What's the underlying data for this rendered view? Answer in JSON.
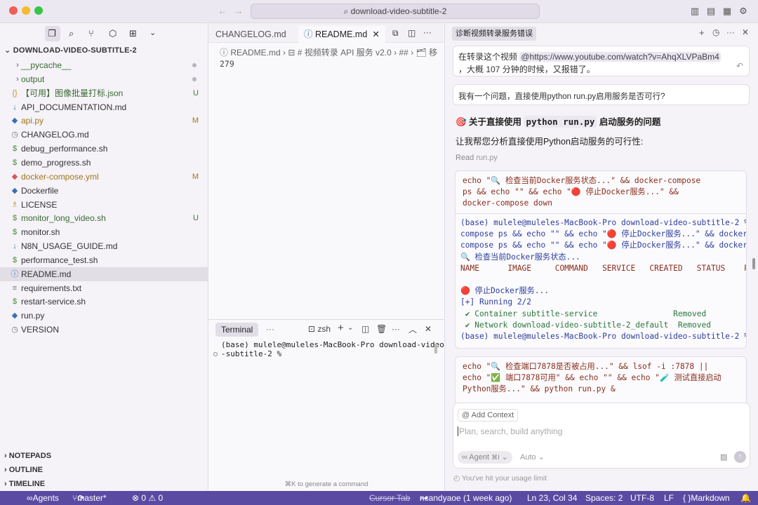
{
  "window": {
    "search": "download-video-subtitle-2"
  },
  "sidebar": {
    "root": "DOWNLOAD-VIDEO-SUBTITLE-2",
    "items": [
      {
        "name": "__pycache__",
        "icon": "›",
        "badge": "",
        "dot": true,
        "color": "#3a6b32"
      },
      {
        "name": "output",
        "icon": "›",
        "badge": "",
        "dot": true,
        "color": "#3a6b32"
      },
      {
        "name": "【可用】图像批量打标.json",
        "icon": "{}",
        "badge": "U",
        "dot": false,
        "color": "#3a6b32"
      },
      {
        "name": "API_DOCUMENTATION.md",
        "icon": "↓",
        "badge": "",
        "dot": false,
        "color": "#333"
      },
      {
        "name": "api.py",
        "icon": "◆",
        "badge": "M",
        "dot": false,
        "color": "#a0781a"
      },
      {
        "name": "CHANGELOG.md",
        "icon": "◷",
        "badge": "",
        "dot": false,
        "color": "#333"
      },
      {
        "name": "debug_performance.sh",
        "icon": "$",
        "badge": "",
        "dot": false,
        "color": "#333"
      },
      {
        "name": "demo_progress.sh",
        "icon": "$",
        "badge": "",
        "dot": false,
        "color": "#333"
      },
      {
        "name": "docker-compose.yml",
        "icon": "◆",
        "badge": "M",
        "dot": false,
        "color": "#a0781a"
      },
      {
        "name": "Dockerfile",
        "icon": "◆",
        "badge": "",
        "dot": false,
        "color": "#333"
      },
      {
        "name": "LICENSE",
        "icon": "♗",
        "badge": "",
        "dot": false,
        "color": "#333"
      },
      {
        "name": "monitor_long_video.sh",
        "icon": "$",
        "badge": "U",
        "dot": false,
        "color": "#3a6b32"
      },
      {
        "name": "monitor.sh",
        "icon": "$",
        "badge": "",
        "dot": false,
        "color": "#333"
      },
      {
        "name": "N8N_USAGE_GUIDE.md",
        "icon": "↓",
        "badge": "",
        "dot": false,
        "color": "#333"
      },
      {
        "name": "performance_test.sh",
        "icon": "$",
        "badge": "",
        "dot": false,
        "color": "#333"
      },
      {
        "name": "README.md",
        "icon": "ⓘ",
        "badge": "",
        "dot": false,
        "color": "#333",
        "selected": true
      },
      {
        "name": "requirements.txt",
        "icon": "≡",
        "badge": "",
        "dot": false,
        "color": "#333"
      },
      {
        "name": "restart-service.sh",
        "icon": "$",
        "badge": "",
        "dot": false,
        "color": "#333"
      },
      {
        "name": "run.py",
        "icon": "◆",
        "badge": "",
        "dot": false,
        "color": "#333"
      },
      {
        "name": "VERSION",
        "icon": "◷",
        "badge": "",
        "dot": false,
        "color": "#333"
      }
    ],
    "sections": [
      "NOTEPADS",
      "OUTLINE",
      "TIMELINE"
    ]
  },
  "editor": {
    "tabs": [
      "CHANGELOG.md",
      "README.md"
    ],
    "breadcrumb": [
      "README.md",
      "# 视频转录 API 服务 v2.0",
      "##",
      "移"
    ],
    "line": "279"
  },
  "terminal": {
    "tab": "Terminal",
    "shell": "zsh",
    "lines": [
      "(base) mulele@muleles-MacBook-Pro download-video",
      "-subtitle-2 %"
    ],
    "hint": "⌘K to generate a command"
  },
  "chat": {
    "title": "诊断视频转录服务错误",
    "msg1_a": "在转录这个视频",
    "msg1_link": "@https://www.youtube.com/watch?v=AhqXLVPaBm4",
    "msg1_b": "，大概 107 分钟的时候，又报错了。",
    "msg2": "我有一个问题，直接使用python run.py启用服务是否可行?",
    "heading_a": "关于直接使用",
    "heading_code": "python run.py",
    "heading_b": "启动服务的问题",
    "intro": "让我帮您分析直接使用Python启动服务的可行性:",
    "read": "Read",
    "read_file": "run.py",
    "input_context": "Add Context",
    "input_placeholder": "Plan, search, build anything",
    "agent": "Agent",
    "agent_kbd": "⌘I",
    "auto": "Auto",
    "limit": "You've hit your usage limit"
  },
  "status": {
    "agents": "Agents",
    "branch": "master*",
    "problems": "⊗ 0 ⚠ 0",
    "cursor_tab": "Cursor Tab",
    "blame": "ncandyaoe (1 week ago)",
    "pos": "Ln 23, Col 34",
    "spaces": "Spaces: 2",
    "enc": "UTF-8",
    "eol": "LF",
    "lang": "Markdown"
  },
  "code1": {
    "cmd": [
      "echo \"🔍 检查当前Docker服务状态...\" && docker-compose",
      "ps && echo \"\" && echo \"🔴 停止Docker服务...\" &&",
      "docker-compose down"
    ],
    "out": [
      "(base) mulele@muleles-MacBook-Pro download-video-subtitle-2 %",
      "compose ps && echo \"\" && echo \"🔴 停止Docker服务...\" && dockerec",
      "compose ps && echo \"\" && echo \"🔴 停止Docker服务...\" && docker-c",
      "🔍 检查当前Docker服务状态...",
      "NAME      IMAGE     COMMAND   SERVICE   CREATED   STATUS    PO",
      "",
      "🔴 停止Docker服务...",
      "[+] Running 2/2",
      " ✔ Container subtitle-service                Removed",
      " ✔ Network download-video-subtitle-2_default  Removed",
      "(base) mulele@muleles-MacBook-Pro download-video-subtitle-2 %"
    ]
  },
  "code2": {
    "cmd": [
      "echo \"🔍 检查端口7878是否被占用...\" && lsof -i :7878 ||",
      "echo \"✅ 端口7878可用\" && echo \"\" && echo \"🧪 测试直接启动",
      "Python服务...\" && python run.py &"
    ]
  }
}
